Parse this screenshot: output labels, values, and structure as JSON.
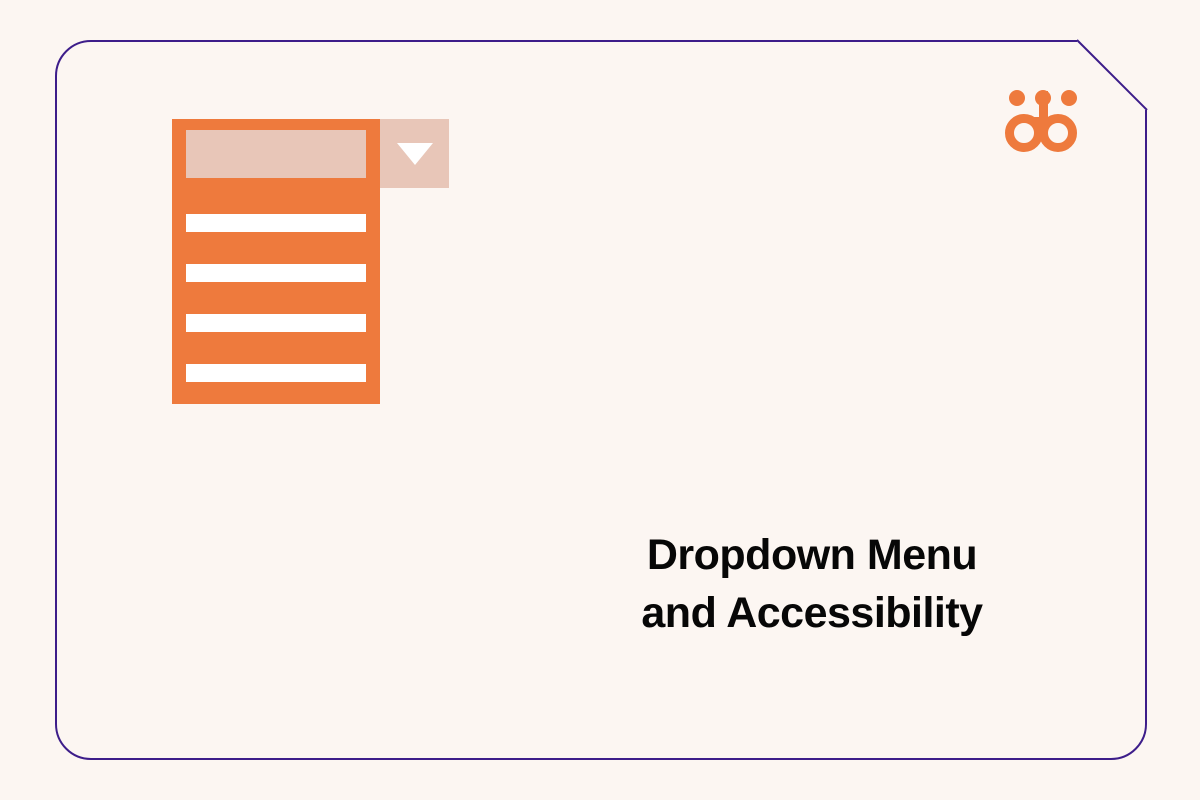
{
  "title": {
    "line1": "Dropdown Menu",
    "line2": "and Accessibility"
  },
  "colors": {
    "accent": "#ee7a3d",
    "border": "#3d1d8a",
    "bg": "#fcf6f2",
    "field": "#e8c6b8"
  },
  "logo": {
    "dot_count": 3,
    "text": "ab"
  },
  "dropdown": {
    "item_count": 4
  }
}
